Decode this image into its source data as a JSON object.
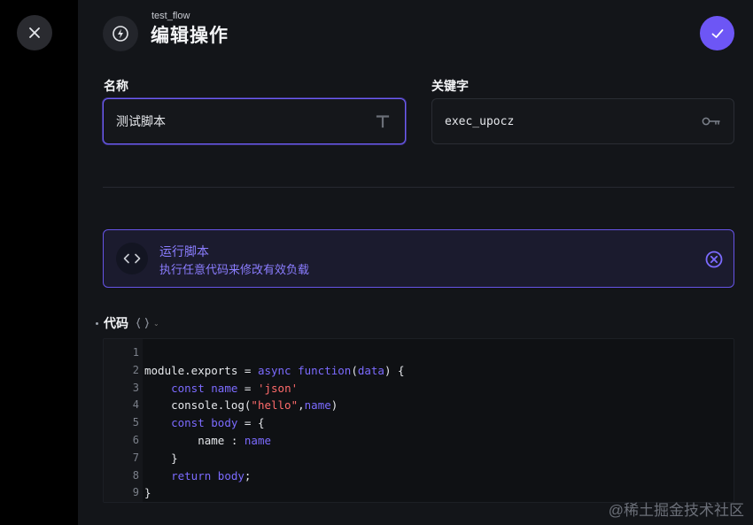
{
  "header": {
    "flow_name": "test_flow",
    "title": "编辑操作",
    "header_icon": "lightning-icon",
    "close_icon": "close-icon",
    "confirm_icon": "check-icon"
  },
  "form": {
    "name_label": "名称",
    "name_value": "测试脚本",
    "name_icon": "text-t-icon",
    "key_label": "关键字",
    "key_value": "exec_upocz",
    "key_icon": "key-icon"
  },
  "action": {
    "title": "运行脚本",
    "description": "执行任意代码来修改有效负载",
    "icon": "code-icon",
    "remove_icon": "circle-x-icon"
  },
  "code_section": {
    "label": "代码",
    "label_icon": "braces-icon",
    "lines": [
      [],
      [
        [
          "module.exports = ",
          ""
        ],
        [
          "async",
          "kw"
        ],
        [
          " ",
          ""
        ],
        [
          "function",
          "kw"
        ],
        [
          "(",
          ""
        ],
        [
          "data",
          "kw"
        ],
        [
          ") {",
          ""
        ]
      ],
      [
        [
          "    ",
          ""
        ],
        [
          "const",
          "kw"
        ],
        [
          " ",
          ""
        ],
        [
          "name",
          "kw"
        ],
        [
          " = ",
          ""
        ],
        [
          "'json'",
          "str"
        ]
      ],
      [
        [
          "    console.log(",
          ""
        ],
        [
          "\"hello\"",
          "str"
        ],
        [
          ",",
          ""
        ],
        [
          "name",
          "kw"
        ],
        [
          ")",
          ""
        ]
      ],
      [
        [
          "    ",
          ""
        ],
        [
          "const",
          "kw"
        ],
        [
          " ",
          ""
        ],
        [
          "body",
          "kw"
        ],
        [
          " = {",
          ""
        ]
      ],
      [
        [
          "        name : ",
          ""
        ],
        [
          "name",
          "kw"
        ]
      ],
      [
        [
          "    }",
          ""
        ]
      ],
      [
        [
          "    ",
          ""
        ],
        [
          "return",
          "kw"
        ],
        [
          " ",
          ""
        ],
        [
          "body",
          "kw"
        ],
        [
          ";",
          ""
        ]
      ],
      [
        [
          "}",
          ""
        ]
      ]
    ]
  },
  "watermark": "@稀土掘金技术社区",
  "colors": {
    "accent": "#6d56f5",
    "panel_bg": "#131519",
    "keyword": "#7c6bff",
    "string": "#ff6b6b"
  }
}
